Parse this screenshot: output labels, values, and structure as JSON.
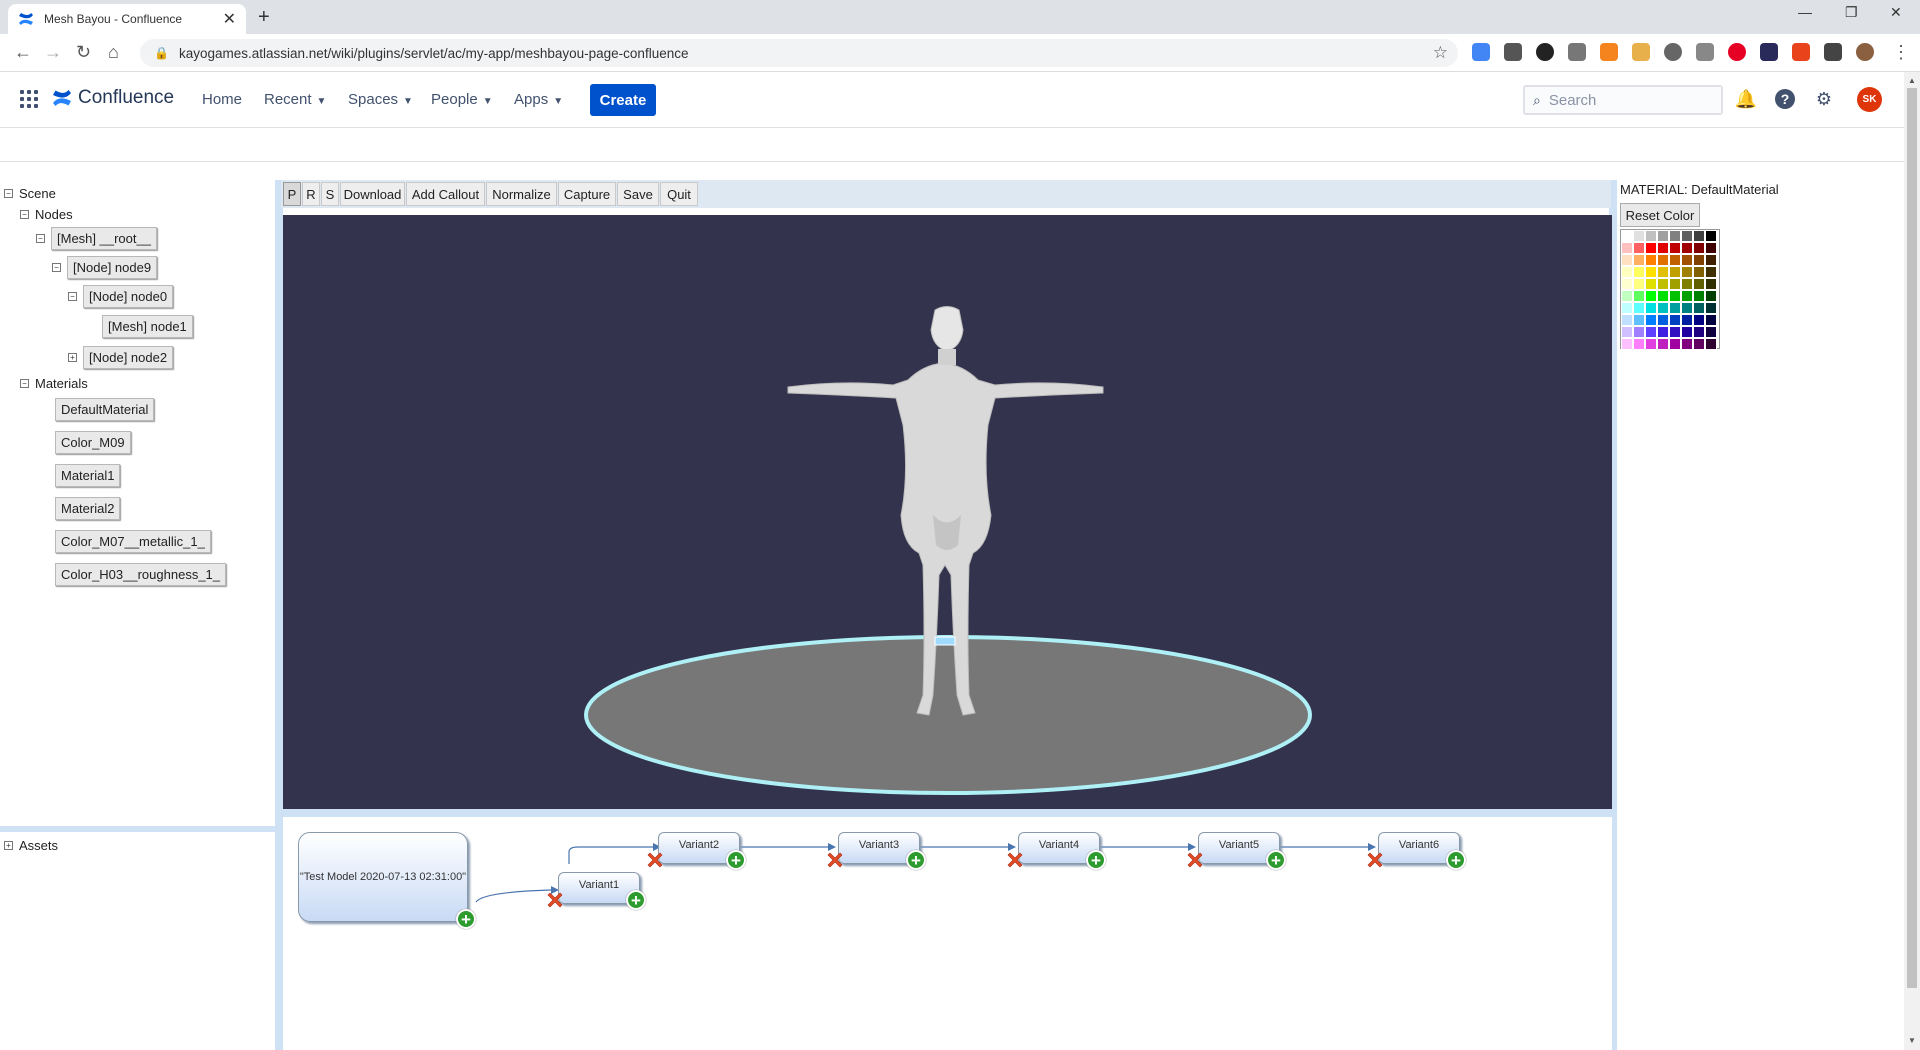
{
  "browser": {
    "tab_title": "Mesh Bayou - Confluence",
    "url": "kayogames.atlassian.net/wiki/plugins/servlet/ac/my-app/meshbayou-page-confluence"
  },
  "header": {
    "product": "Confluence",
    "nav": {
      "home": "Home",
      "recent": "Recent",
      "spaces": "Spaces",
      "people": "People",
      "apps": "Apps"
    },
    "create": "Create",
    "search_placeholder": "Search",
    "avatar_initials": "SK"
  },
  "scene": {
    "root": "Scene",
    "nodes_label": "Nodes",
    "nodes": {
      "root_mesh": "[Mesh] __root__",
      "node9": "[Node] node9",
      "node0": "[Node] node0",
      "node1": "[Mesh] node1",
      "node2": "[Node] node2"
    },
    "materials_label": "Materials",
    "materials": [
      "DefaultMaterial",
      "Color_M09",
      "Material1",
      "Material2",
      "Color_M07__metallic_1_",
      "Color_H03__roughness_1_"
    ],
    "assets_label": "Assets"
  },
  "toolbar": {
    "p": "P",
    "r": "R",
    "s": "S",
    "download": "Download",
    "add_callout": "Add Callout",
    "normalize": "Normalize",
    "capture": "Capture",
    "save": "Save",
    "quit": "Quit"
  },
  "variants": {
    "root": "\"Test Model 2020-07-13 02:31:00\"",
    "items": [
      "Variant1",
      "Variant2",
      "Variant3",
      "Variant4",
      "Variant5",
      "Variant6"
    ]
  },
  "material_panel": {
    "title": "MATERIAL: DefaultMaterial",
    "reset": "Reset Color",
    "palette": [
      [
        "#ffffff",
        "#e0e0e0",
        "#c0c0c0",
        "#a0a0a0",
        "#808080",
        "#606060",
        "#404040",
        "#000000"
      ],
      [
        "#ffc0c0",
        "#ff6060",
        "#ff0000",
        "#e00000",
        "#c00000",
        "#a00000",
        "#800000",
        "#400000"
      ],
      [
        "#ffe0c0",
        "#ffb060",
        "#ff8000",
        "#e07000",
        "#c06000",
        "#a05000",
        "#804000",
        "#402000"
      ],
      [
        "#ffffc0",
        "#ffff60",
        "#ffe000",
        "#e0c000",
        "#c0a000",
        "#a08000",
        "#806000",
        "#403000"
      ],
      [
        "#ffffd0",
        "#ffff80",
        "#e0e000",
        "#c0c000",
        "#a0a000",
        "#808000",
        "#606000",
        "#303000"
      ],
      [
        "#c0ffc0",
        "#60ff60",
        "#00ff00",
        "#00e000",
        "#00c000",
        "#00a000",
        "#008000",
        "#004000"
      ],
      [
        "#c0ffff",
        "#60ffff",
        "#00e0e0",
        "#00c0c0",
        "#00a0a0",
        "#008080",
        "#006060",
        "#003030"
      ],
      [
        "#c0e0ff",
        "#60c0ff",
        "#0080ff",
        "#0060e0",
        "#0040c0",
        "#0020a0",
        "#000080",
        "#000040"
      ],
      [
        "#d0c0ff",
        "#a080ff",
        "#6040ff",
        "#4020e0",
        "#3010c0",
        "#2000a0",
        "#200080",
        "#100040"
      ],
      [
        "#ffc0ff",
        "#ff80ff",
        "#e040e0",
        "#c020c0",
        "#a000a0",
        "#800080",
        "#600060",
        "#300030"
      ]
    ]
  },
  "colors": {
    "confluence_blue": "#0052cc",
    "viewport_bg": "#33334d",
    "avatar": "#de350b",
    "splitter": "#cfe2f5"
  }
}
